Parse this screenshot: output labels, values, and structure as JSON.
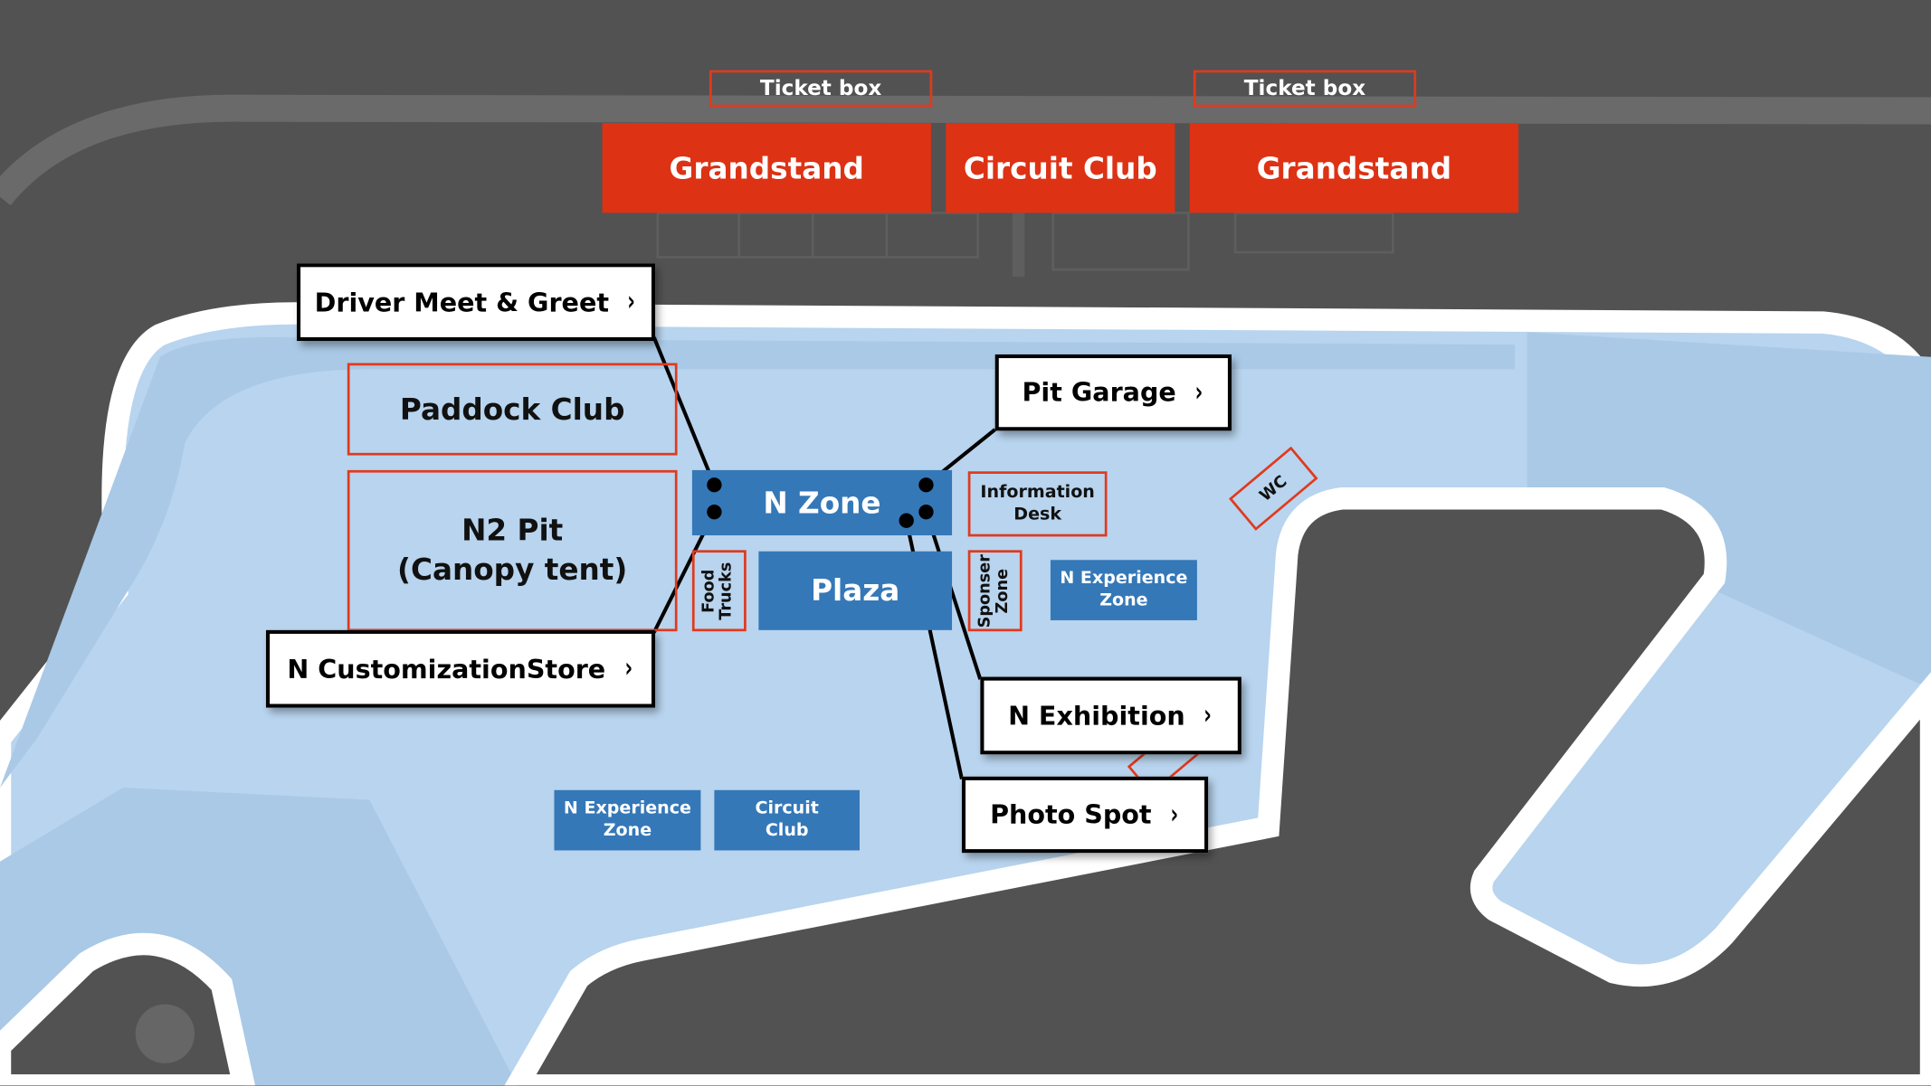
{
  "colors": {
    "background": "#525252",
    "venue_area": "#b8d4ee",
    "track": "#ffffff",
    "grandstand": "#dd3214",
    "zone_blue": "#3578b8",
    "outline_red": "#e03a1e"
  },
  "top": {
    "ticket_boxes": [
      "Ticket box",
      "Ticket box"
    ],
    "grandstand_left": "Grandstand",
    "circuit_club": "Circuit Club",
    "grandstand_right": "Grandstand"
  },
  "areas": {
    "paddock_club": "Paddock Club",
    "n2_pit_line1": "N2 Pit",
    "n2_pit_line2": "(Canopy tent)",
    "n_zone": "N Zone",
    "plaza": "Plaza",
    "food_trucks_line1": "Food",
    "food_trucks_line2": "Trucks",
    "sponser_zone_line1": "Sponser",
    "sponser_zone_line2": "Zone",
    "information_desk_line1": "Information",
    "information_desk_line2": "Desk",
    "n_experience_zone_right_line1": "N Experience",
    "n_experience_zone_right_line2": "Zone",
    "n_experience_zone_bottom_line1": "N Experience",
    "n_experience_zone_bottom_line2": "Zone",
    "circuit_club_bottom_line1": "Circuit",
    "circuit_club_bottom_line2": "Club",
    "wc": "WC"
  },
  "callouts": {
    "driver_meet_greet": "Driver Meet & Greet",
    "pit_garage": "Pit Garage",
    "n_customization_store": "N CustomizationStore",
    "n_exhibition": "N Exhibition",
    "photo_spot": "Photo Spot",
    "chevron": "›"
  }
}
